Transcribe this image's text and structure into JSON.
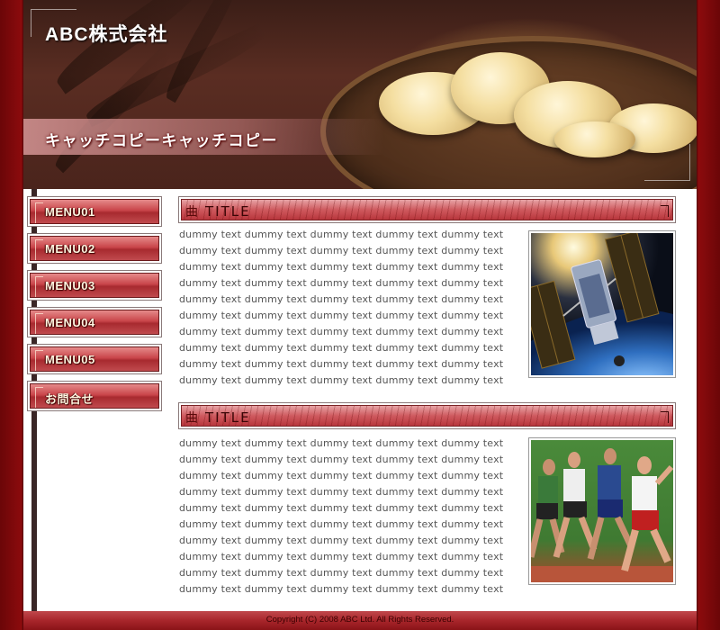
{
  "header": {
    "company_name": "ABC株式会社",
    "catchcopy": "キャッチコピーキャッチコピー"
  },
  "nav": {
    "items": [
      {
        "label": "MENU01"
      },
      {
        "label": "MENU02"
      },
      {
        "label": "MENU03"
      },
      {
        "label": "MENU04"
      },
      {
        "label": "MENU05"
      },
      {
        "label": "お問合せ"
      }
    ]
  },
  "sections": [
    {
      "title": "TITLE",
      "title_mark": "曲",
      "lines": [
        "dummy text dummy text dummy text dummy text dummy text",
        "dummy text dummy text dummy text dummy text dummy text",
        "dummy text dummy text dummy text dummy text dummy text",
        "dummy text dummy text dummy text dummy text dummy text",
        "dummy text dummy text dummy text dummy text dummy text",
        "dummy text dummy text dummy text dummy text dummy text",
        "dummy text dummy text dummy text dummy text dummy text",
        "dummy text dummy text dummy text dummy text dummy text",
        "dummy text dummy text dummy text dummy text dummy text",
        "dummy text dummy text dummy text dummy text dummy text"
      ],
      "photo_icon": "satellite-photo"
    },
    {
      "title": "TITLE",
      "title_mark": "曲",
      "lines": [
        "dummy text dummy text dummy text dummy text dummy text",
        "dummy text dummy text dummy text dummy text dummy text",
        "dummy text dummy text dummy text dummy text dummy text",
        "dummy text dummy text dummy text dummy text dummy text",
        "dummy text dummy text dummy text dummy text dummy text",
        "dummy text dummy text dummy text dummy text dummy text",
        "dummy text dummy text dummy text dummy text dummy text",
        "dummy text dummy text dummy text dummy text dummy text",
        "dummy text dummy text dummy text dummy text dummy text",
        "dummy text dummy text dummy text dummy text dummy text"
      ],
      "photo_icon": "runners-photo"
    }
  ],
  "footer": {
    "copyright": "Copyright (C) 2008 ABC Ltd. All Rights Reserved."
  },
  "colors": {
    "accent": "#c0484c",
    "frame": "#5a0607"
  }
}
